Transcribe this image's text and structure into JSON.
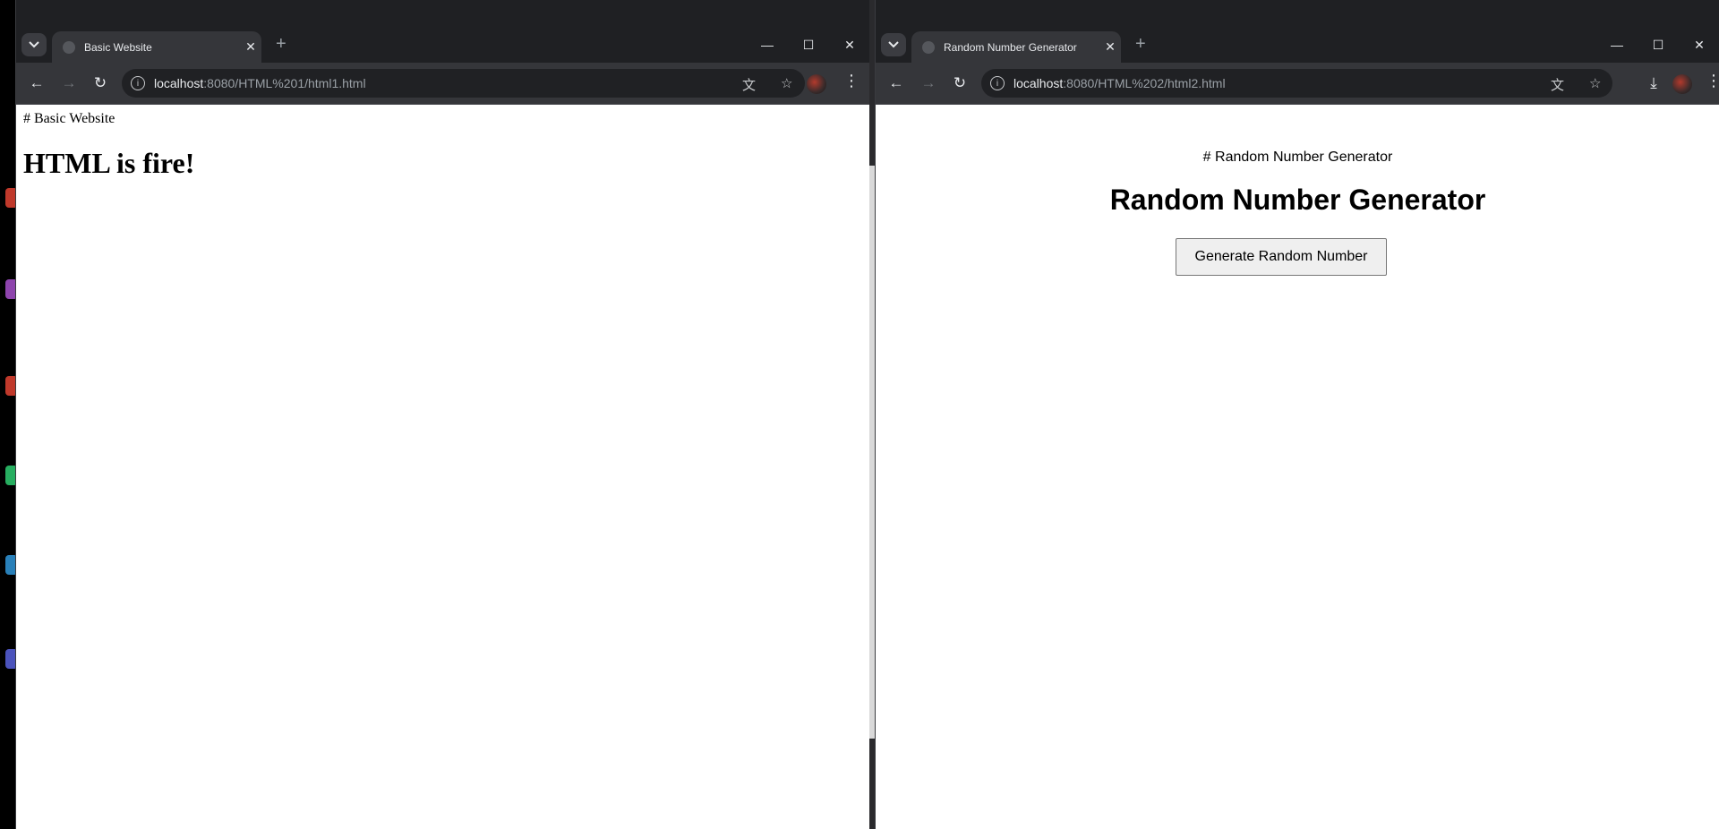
{
  "left_window": {
    "tab_title": "Basic Website",
    "address_host": "localhost",
    "address_path": ":8080/HTML%201/html1.html",
    "page": {
      "comment_text": "# Basic Website",
      "heading": "HTML is fire!"
    }
  },
  "right_window": {
    "tab_title": "Random Number Generator",
    "address_host": "localhost",
    "address_path": ":8080/HTML%202/html2.html",
    "page": {
      "comment_text": "# Random Number Generator",
      "heading": "Random Number Generator",
      "button_label": "Generate Random Number"
    }
  },
  "icons": {
    "dropdown": "chevron-down-icon",
    "favicon": "globe-icon",
    "close_tab": "close-icon",
    "new_tab": "plus-icon",
    "minimize": "minimize-icon",
    "maximize": "maximize-icon",
    "close_window": "close-icon",
    "back": "back-arrow-icon",
    "forward": "forward-arrow-icon",
    "reload": "reload-icon",
    "info": "info-icon",
    "translate": "translate-icon",
    "bookmark": "star-icon",
    "download": "download-icon",
    "profile": "avatar",
    "menu": "kebab-menu-icon"
  },
  "colors": {
    "tabstrip": "#1f2023",
    "toolbar": "#35363a",
    "omnibox": "#202124",
    "page_bg": "#ffffff"
  }
}
